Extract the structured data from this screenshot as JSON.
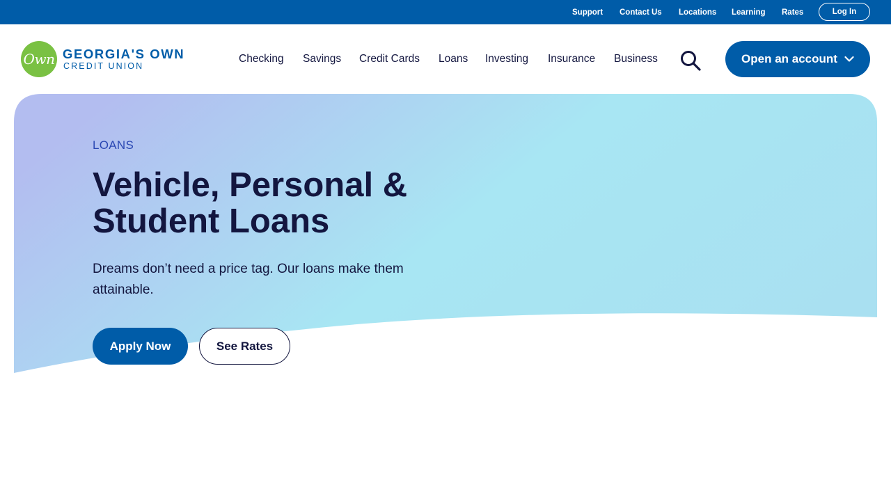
{
  "utility_nav": {
    "links": [
      "Support",
      "Contact Us",
      "Locations",
      "Learning",
      "Rates"
    ],
    "login_label": "Log In"
  },
  "logo": {
    "mark_text": "Own",
    "line1": "GEORGIA'S OWN",
    "line2": "CREDIT UNION"
  },
  "main_nav": {
    "items": [
      "Checking",
      "Savings",
      "Credit Cards",
      "Loans",
      "Investing",
      "Insurance",
      "Business"
    ],
    "search_icon": "search-icon",
    "cta_label": "Open an account"
  },
  "hero": {
    "eyebrow": "LOANS",
    "title": "Vehicle, Personal & Student Loans",
    "subtitle": "Dreams don’t need a price tag. Our loans make them attainable.",
    "primary_button": "Apply Now",
    "secondary_button": "See Rates"
  },
  "colors": {
    "brand_blue": "#005ca8",
    "logo_green": "#7ac143",
    "navy_text": "#13163f",
    "gradient_start": "#b3bdf0",
    "gradient_end": "#a8e6f3"
  }
}
